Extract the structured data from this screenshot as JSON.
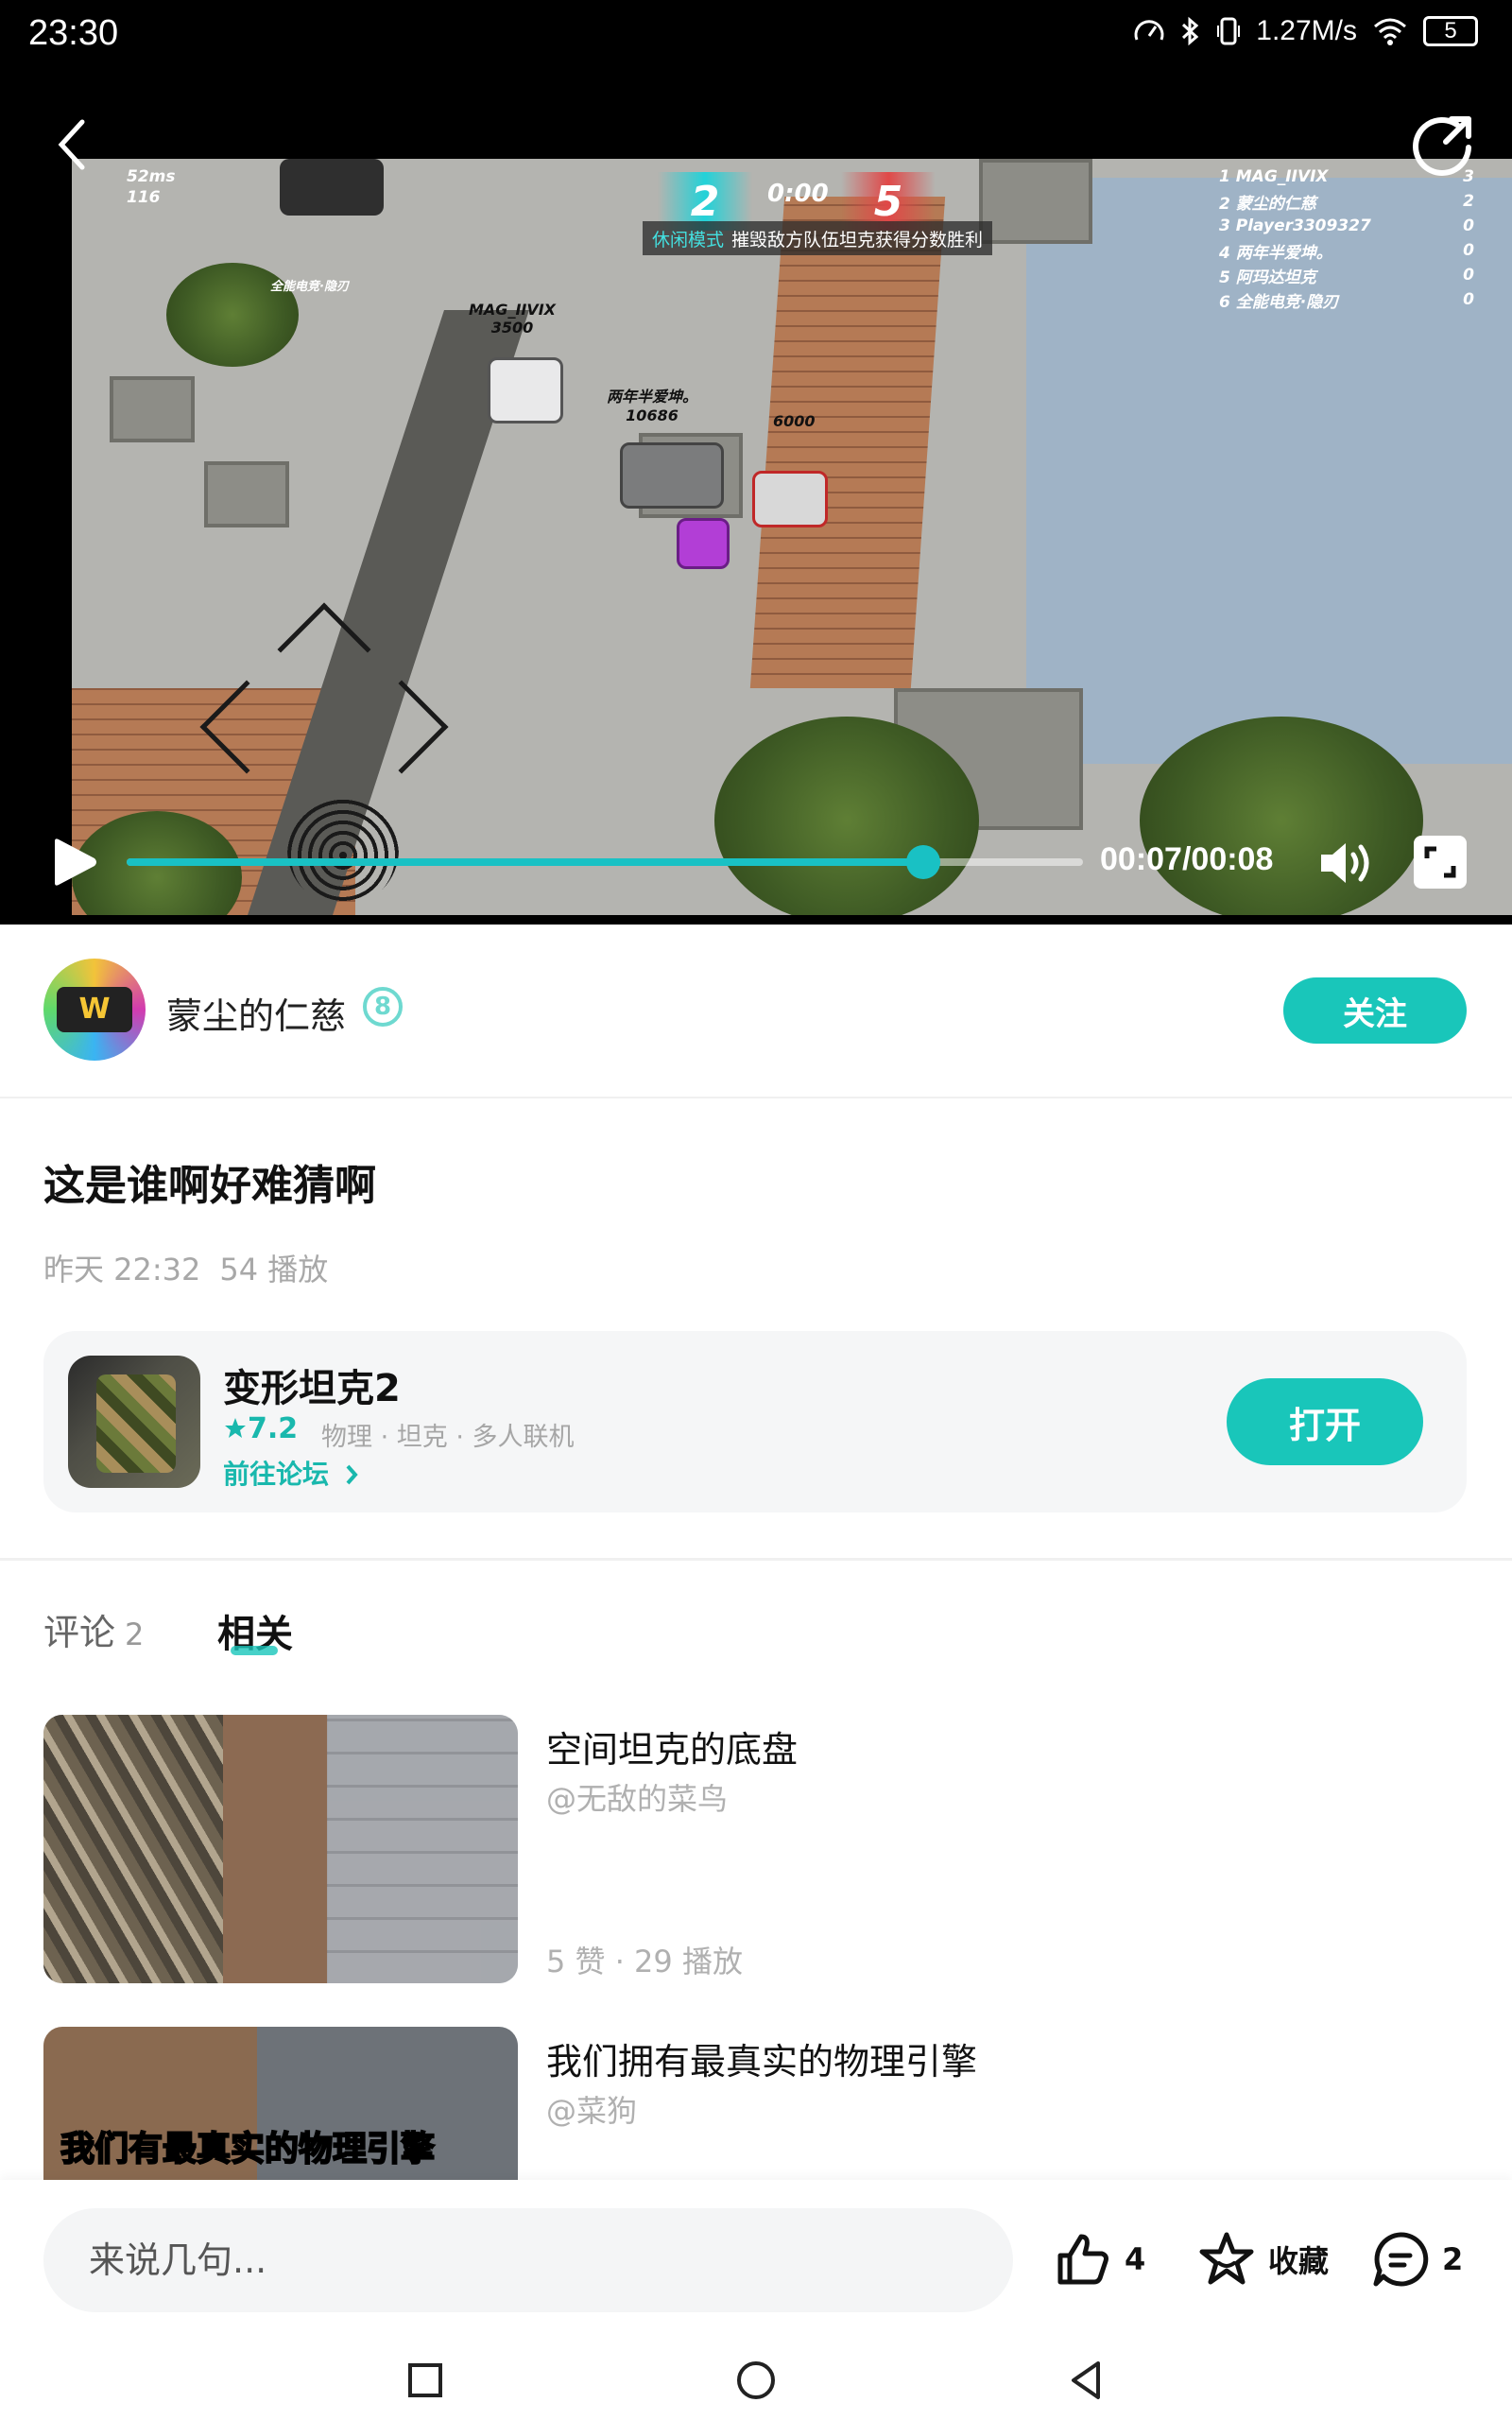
{
  "status_bar": {
    "time": "23:30",
    "network_speed": "1.27M/s",
    "battery": "5",
    "icons": [
      "speedometer-icon",
      "bluetooth-icon",
      "vibrate-icon",
      "wifi-icon",
      "battery-icon"
    ]
  },
  "video": {
    "current_time": "00:07",
    "duration": "00:08",
    "time_label": "00:07/00:08",
    "progress": 0.833,
    "accent_color": "#19c1c4",
    "hud": {
      "ping": "52ms",
      "fps": "116",
      "blue_score": "2",
      "red_score": "5",
      "match_clock": "0:00",
      "mode_tag": "休闲模式",
      "mode_text": "摧毁敌方队伍坦克获得分数胜利",
      "scoreboard": [
        {
          "rank": "1",
          "name": "MAG_IIVIX",
          "score": "3"
        },
        {
          "rank": "2",
          "name": "蒙尘的仁慈",
          "score": "2"
        },
        {
          "rank": "3",
          "name": "Player3309327",
          "score": "0"
        },
        {
          "rank": "4",
          "name": "两年半爱坤。",
          "score": "0"
        },
        {
          "rank": "5",
          "name": "阿玛达坦克",
          "score": "0"
        },
        {
          "rank": "6",
          "name": "全能电竞·隐刃",
          "score": "0"
        }
      ],
      "name_tags": [
        {
          "name": "MAG_IIVIX",
          "hp": "3500"
        },
        {
          "name": "两年半爱坤。",
          "hp": "10686"
        },
        {
          "name": "",
          "hp": "6000"
        },
        {
          "name": "全能电竞·隐刃",
          "hp": ""
        }
      ]
    }
  },
  "author": {
    "name": "蒙尘的仁慈",
    "level": "8",
    "avatar_text": "W",
    "follow_label": "关注"
  },
  "post": {
    "title": "这是谁啊好难猜啊",
    "date": "昨天 22:32",
    "plays": "54 播放"
  },
  "game_card": {
    "name": "变形坦克2",
    "rating": "7.2",
    "tags": "物理 · 坦克 · 多人联机",
    "forum_link": "前往论坛",
    "open_label": "打开"
  },
  "tabs": {
    "comments_label": "评论",
    "comments_count": "2",
    "related_label": "相关",
    "active": "related"
  },
  "related": [
    {
      "title": "空间坦克的底盘",
      "author": "@无敌的菜鸟",
      "stats": "5 赞 · 29 播放"
    },
    {
      "title": "我们拥有最真实的物理引擎",
      "author": "@菜狗",
      "stats": "",
      "thumb_caption": "我们有最真实的物理引擎"
    }
  ],
  "bottom_bar": {
    "comment_placeholder": "来说几句...",
    "like_count": "4",
    "favorite_label": "收藏",
    "comment_count": "2"
  }
}
